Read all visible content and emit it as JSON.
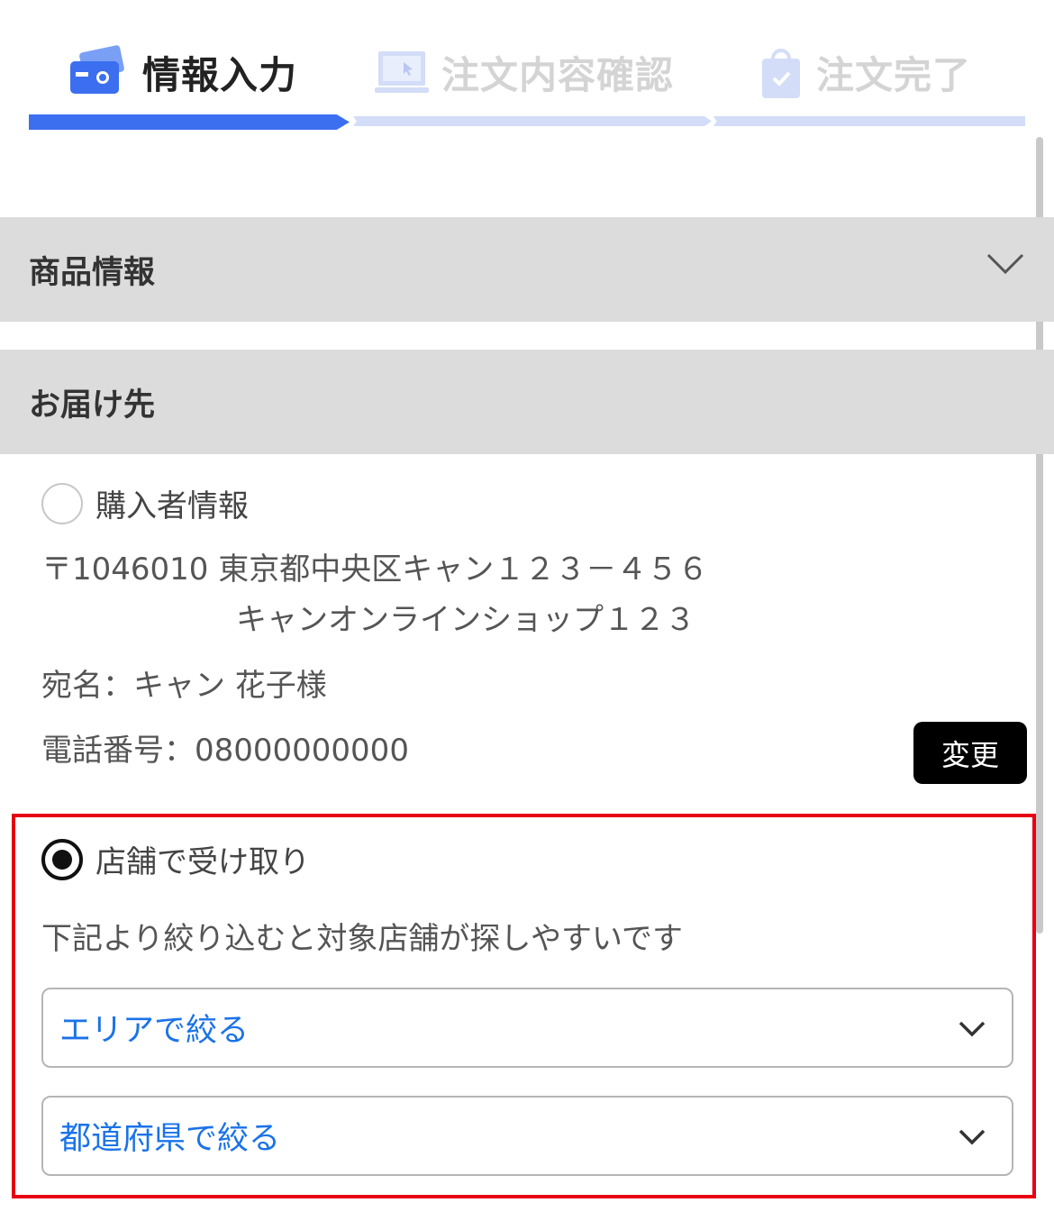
{
  "steps": [
    {
      "label": "情報入力",
      "icon": "credit-card-icon",
      "active": true
    },
    {
      "label": "注文内容確認",
      "icon": "laptop-icon",
      "active": false
    },
    {
      "label": "注文完了",
      "icon": "shopping-bag-icon",
      "active": false
    }
  ],
  "sections": {
    "product": {
      "title": "商品情報"
    },
    "delivery": {
      "title": "お届け先"
    }
  },
  "buyer": {
    "option_label": "購入者情報",
    "postal_address_line1": "〒1046010 東京都中央区キャン１２３－４５６",
    "address_line2": "キャンオンラインショップ１２３",
    "recipient": "宛名：キャン 花子様",
    "phone": "電話番号：08000000000",
    "change_label": "変更"
  },
  "store_pickup": {
    "option_label": "店舗で受け取り",
    "hint": "下記より絞り込むと対象店舗が探しやすいです",
    "area_select": "エリアで絞る",
    "prefecture_select": "都道府県で絞る"
  },
  "colors": {
    "accent": "#3b6ff0",
    "inactive_step": "#d3ddf8",
    "highlight": "#e60012",
    "select_text": "#1a73e8"
  }
}
